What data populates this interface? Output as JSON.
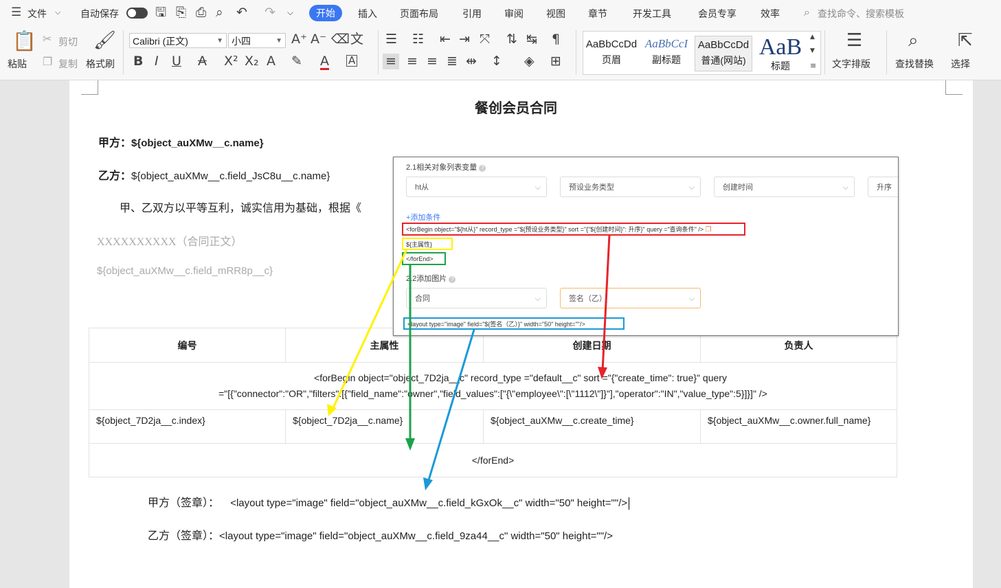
{
  "menu": {
    "file": "文件",
    "autosave": "自动保存",
    "tabs": [
      "开始",
      "插入",
      "页面布局",
      "引用",
      "审阅",
      "视图",
      "章节",
      "开发工具",
      "会员专享",
      "效率"
    ],
    "search_placeholder": "查找命令、搜索模板"
  },
  "ribbon": {
    "paste": "粘贴",
    "cut": "剪切",
    "copy": "复制",
    "format_painter": "格式刷",
    "font_name": "Calibri (正文)",
    "font_size": "小四",
    "styles": [
      {
        "preview": "AaBbCcDd",
        "label": "页眉"
      },
      {
        "preview": "AaBbCcI",
        "label": "副标题"
      },
      {
        "preview": "AaBbCcDd",
        "label": "普通(网站)"
      },
      {
        "preview": "AaB",
        "label": "标题"
      }
    ],
    "text_layout": "文字排版",
    "find_replace": "查找替换",
    "select": "选择"
  },
  "document": {
    "title": "餐创会员合同",
    "party_a_label": "甲方：",
    "party_a_value": "${object_auXMw__c.name}",
    "party_b_label": "乙方：",
    "party_b_value": "${object_auXMw__c.field_JsC8u__c.name}",
    "paragraph": "甲、乙双方以平等互利，诚实信用为基础，根据《",
    "placeholder_text": "XXXXXXXXXX（合同正文）",
    "field_text": "${object_auXMw__c.field_mRR8p__c}",
    "table": {
      "headers": [
        "编号",
        "主属性",
        "创建日期",
        "负责人"
      ],
      "for_begin_line1": "<forBegin object=\"object_7D2ja__c\" record_type =\"default__c\"  sort =\"{\"create_time\": true}\" query",
      "for_begin_line2": "=\"[{\"connector\":\"OR\",\"filters\":[{\"field_name\":\"owner\",\"field_values\":[\"{\\\"employee\\\":[\\\"1112\\\"]}\"],\"operator\":\"IN\",\"value_type\":5}]}]\" />",
      "row": [
        "${object_7D2ja__c.index}",
        "${object_7D2ja__c.name}",
        "${object_auXMw__c.create_time}",
        "${object_auXMw__c.owner.full_name}"
      ],
      "for_end": "</forEnd>"
    },
    "sign_a_label": "甲方（签章）：",
    "sign_a_value": "<layout type=\"image\" field=\"object_auXMw__c.field_kGxOk__c\" width=\"50\" height=\"\"/>",
    "sign_b_label": "乙方（签章）：",
    "sign_b_value": "<layout type=\"image\" field=\"object_auXMw__c.field_9za44__c\" width=\"50\" height=\"\"/>"
  },
  "panel": {
    "section1_title": "2.1相关对象列表变量",
    "select1": "ht从",
    "select2": "预设业务类型",
    "select3": "创建时间",
    "select4": "升序",
    "add_condition": "+添加条件",
    "code_for_begin": "<forBegin object=\"${ht从}\" record_type =\"${预设业务类型}\" sort =\"{\"${创建时间}\": 升序}\" query =\"查询条件\" />",
    "code_main_attr": "${主属性}",
    "code_for_end": "</forEnd>",
    "section2_title": "2.2添加图片",
    "select5": "合同",
    "select6": "签名（乙）",
    "code_layout": "<layout type=\"image\" field=\"${签名（乙）}\" width=\"50\" height=\"\"/>"
  },
  "colors": {
    "accent": "#3a78f2",
    "red": "#e8232a",
    "yellow": "#fff200",
    "green": "#1aa34a",
    "blue": "#1a9ad6",
    "orange_border": "#f5b96e"
  }
}
